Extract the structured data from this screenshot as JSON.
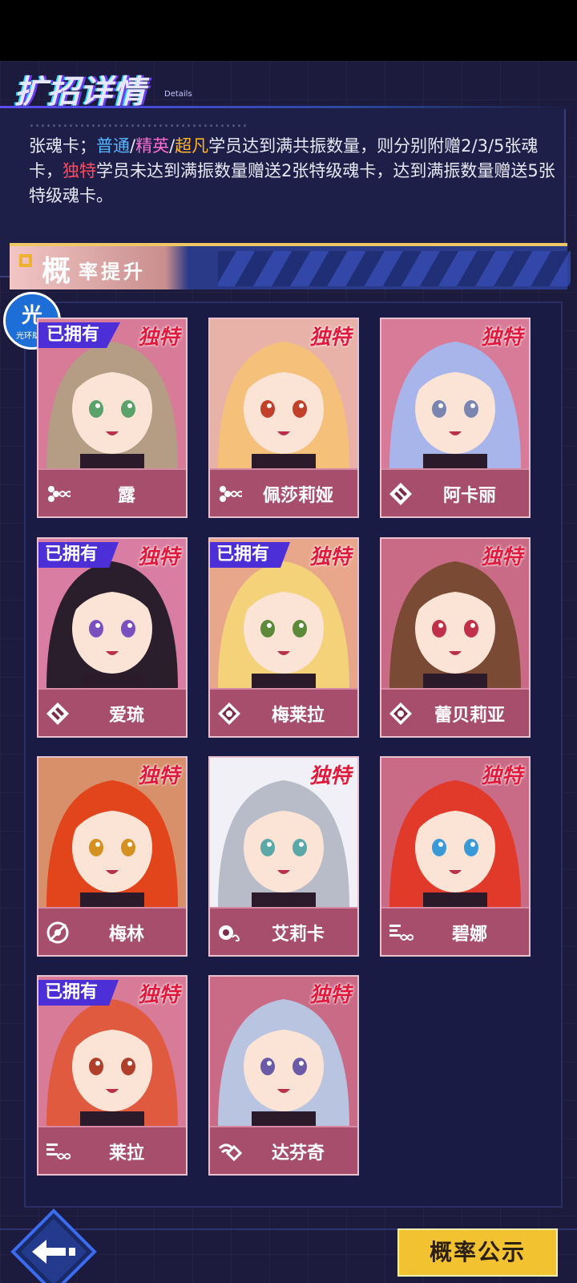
{
  "header": {
    "title": "扩招详情",
    "subtitle": "Details"
  },
  "details": {
    "clipped_line": "…………………………………",
    "segments": [
      {
        "text": "张魂卡；",
        "color": "white"
      },
      {
        "text": "普通",
        "color": "blue"
      },
      {
        "text": "/",
        "color": "white"
      },
      {
        "text": "精英",
        "color": "pink"
      },
      {
        "text": "/",
        "color": "white"
      },
      {
        "text": "超凡",
        "color": "gold"
      },
      {
        "text": "学员达到满共振数量，则分别附赠2/3/5张魂卡，",
        "color": "white"
      },
      {
        "text": "独特",
        "color": "red"
      },
      {
        "text": "学员未达到满振数量赠送2张特级魂卡，达到满振数量赠送5张特级魂卡。",
        "color": "white"
      }
    ]
  },
  "section": {
    "title_big": "概",
    "title_rest": "率提升"
  },
  "assistant": {
    "glyph": "光",
    "label": "光环助手"
  },
  "owned_label": "已拥有",
  "unique_label": "独特",
  "characters": [
    {
      "name": "露",
      "owned": true,
      "owned_cut": true,
      "icon": "dots-infinity-icon",
      "hair": "#b59c85",
      "bg": "#d77b98",
      "eye": "#5aa26a"
    },
    {
      "name": "佩莎莉娅",
      "owned": false,
      "icon": "dots-infinity-icon",
      "hair": "#f4c07a",
      "bg": "#e9b2a8",
      "eye": "#c0402a"
    },
    {
      "name": "阿卡丽",
      "owned": false,
      "icon": "diamond-cross-icon",
      "hair": "#a8b5ea",
      "bg": "#d77b98",
      "eye": "#7a86b0"
    },
    {
      "name": "爱琉",
      "owned": true,
      "icon": "diamond-cross-icon",
      "hair": "#2a1d2c",
      "bg": "#d97ea2",
      "eye": "#7a4fc0"
    },
    {
      "name": "梅莱拉",
      "owned": true,
      "icon": "diamond-dot-icon",
      "hair": "#f4d27a",
      "bg": "#e8a78a",
      "eye": "#5c8a3a"
    },
    {
      "name": "蕾贝莉亚",
      "owned": false,
      "icon": "diamond-dot-icon",
      "hair": "#7a4a34",
      "bg": "#c96a86",
      "eye": "#c03048"
    },
    {
      "name": "梅林",
      "owned": false,
      "icon": "orbit-icon",
      "hair": "#e2451c",
      "bg": "#d7906a",
      "eye": "#d49020"
    },
    {
      "name": "艾莉卡",
      "owned": false,
      "icon": "eye-infinity-icon",
      "hair": "#b8bcc8",
      "bg": "#f0f0f6",
      "eye": "#5aa8a8"
    },
    {
      "name": "碧娜",
      "owned": false,
      "icon": "stripes-infinity-icon",
      "hair": "#e23a2a",
      "bg": "#c96a86",
      "eye": "#3a9ad8"
    },
    {
      "name": "莱拉",
      "owned": true,
      "icon": "stripes-infinity-icon",
      "hair": "#e05a40",
      "bg": "#d77b98",
      "eye": "#b0402a"
    },
    {
      "name": "达芬奇",
      "owned": false,
      "icon": "signal-diamond-icon",
      "hair": "#b8c4e0",
      "bg": "#c96a86",
      "eye": "#6a5aa8"
    }
  ],
  "buttons": {
    "probability": "概率公示"
  }
}
